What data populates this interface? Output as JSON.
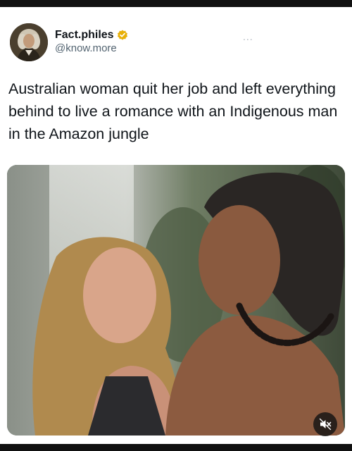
{
  "account": {
    "display_name": "Fact.philes",
    "handle": "@know.more",
    "verified": true,
    "verified_color": "#e8b007",
    "avatar_icon": "portrait-avatar"
  },
  "post": {
    "more_label": "...",
    "text": "Australian woman quit her job and left everything behind to live a romance with an Indigenous man in the Amazon jungle",
    "media": {
      "type": "video",
      "muted": true,
      "mute_icon": "speaker-muted-icon"
    }
  }
}
